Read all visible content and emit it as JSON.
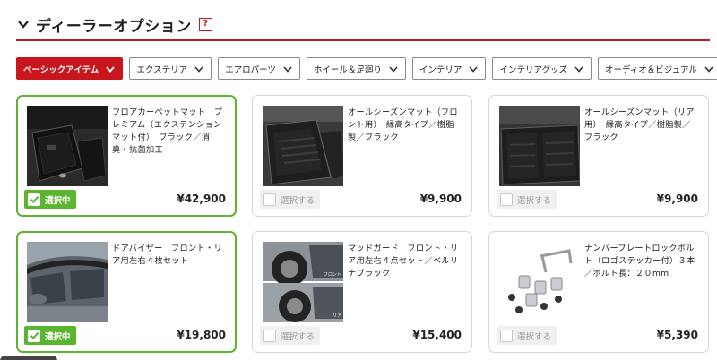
{
  "header": {
    "title": "ディーラーオプション",
    "help": "?"
  },
  "tabs": [
    {
      "label": "ベーシックアイテム",
      "active": true
    },
    {
      "label": "エクステリア",
      "active": false
    },
    {
      "label": "エアロパーツ",
      "active": false
    },
    {
      "label": "ホイール＆足廻り",
      "active": false
    },
    {
      "label": "インテリア",
      "active": false
    },
    {
      "label": "インテリアグッズ",
      "active": false
    },
    {
      "label": "オーディオ＆ビジュアル",
      "active": false
    }
  ],
  "products": [
    {
      "name": "フロアカーペットマット　プレミアム（エクステンションマット付）　ブラック／消臭・抗菌加工",
      "price": "¥42,900",
      "status": "選択中",
      "selected": true,
      "image": "floor-mat-image"
    },
    {
      "name": "オールシーズンマット（フロント用）　縁高タイプ／樹脂製／ブラック",
      "price": "¥9,900",
      "status": "選択する",
      "selected": false,
      "image": "all-season-mat-front-image"
    },
    {
      "name": "オールシーズンマット（リア用）　縁高タイプ／樹脂製／ブラック",
      "price": "¥9,900",
      "status": "選択する",
      "selected": false,
      "image": "all-season-mat-rear-image"
    },
    {
      "name": "ドアバイザー　フロント・リア用左右４枚セット",
      "price": "¥19,800",
      "status": "選択中",
      "selected": true,
      "image": "door-visor-image"
    },
    {
      "name": "マッドガード　フロント・リア用左右４点セット／ベルリナブラック",
      "price": "¥15,400",
      "status": "選択する",
      "selected": false,
      "image": "mud-guard-image",
      "image_labels": [
        "フロント",
        "リア"
      ]
    },
    {
      "name": "ナンバープレートロックボルト（ロゴステッカー付）３本／ボルト長：２０mm",
      "price": "¥5,390",
      "status": "選択する",
      "selected": false,
      "image": "lock-bolt-image"
    }
  ],
  "colors": {
    "accent": "#c8161d",
    "selected": "#5cb531"
  }
}
